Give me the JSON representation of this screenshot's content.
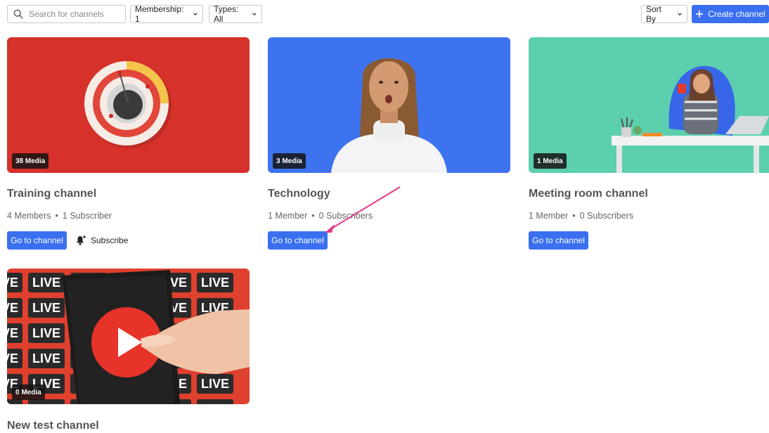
{
  "toolbar": {
    "search_placeholder": "Search for channels",
    "membership_label": "Membership: 1",
    "types_label": "Types: All",
    "sort_label": "Sort By",
    "create_label": "Create channel"
  },
  "channels": [
    {
      "title": "Training channel",
      "media_badge": "38 Media",
      "members": "4 Members",
      "subscribers": "1 Subscriber",
      "go_label": "Go to channel",
      "subscribe_label": "Subscribe",
      "thumb_color": "#d6312a"
    },
    {
      "title": "Technology",
      "media_badge": "3 Media",
      "members": "1 Member",
      "subscribers": "0 Subscribers",
      "go_label": "Go to channel",
      "thumb_color": "#3e73ef"
    },
    {
      "title": "Meeting room channel",
      "media_badge": "1 Media",
      "members": "1 Member",
      "subscribers": "0 Subscribers",
      "go_label": "Go to channel",
      "thumb_color": "#5ccfae"
    },
    {
      "title": "New test channel",
      "media_badge": "0 Media",
      "thumb_color": "#e0402e",
      "live_text": "LIVE"
    }
  ],
  "colors": {
    "primary": "#3a6ff0",
    "annotation_arrow": "#e23a8a"
  },
  "icons": {
    "search": "search-icon",
    "chevron": "chevron-down-icon",
    "plus": "plus-icon",
    "bell": "bell-plus-icon"
  }
}
